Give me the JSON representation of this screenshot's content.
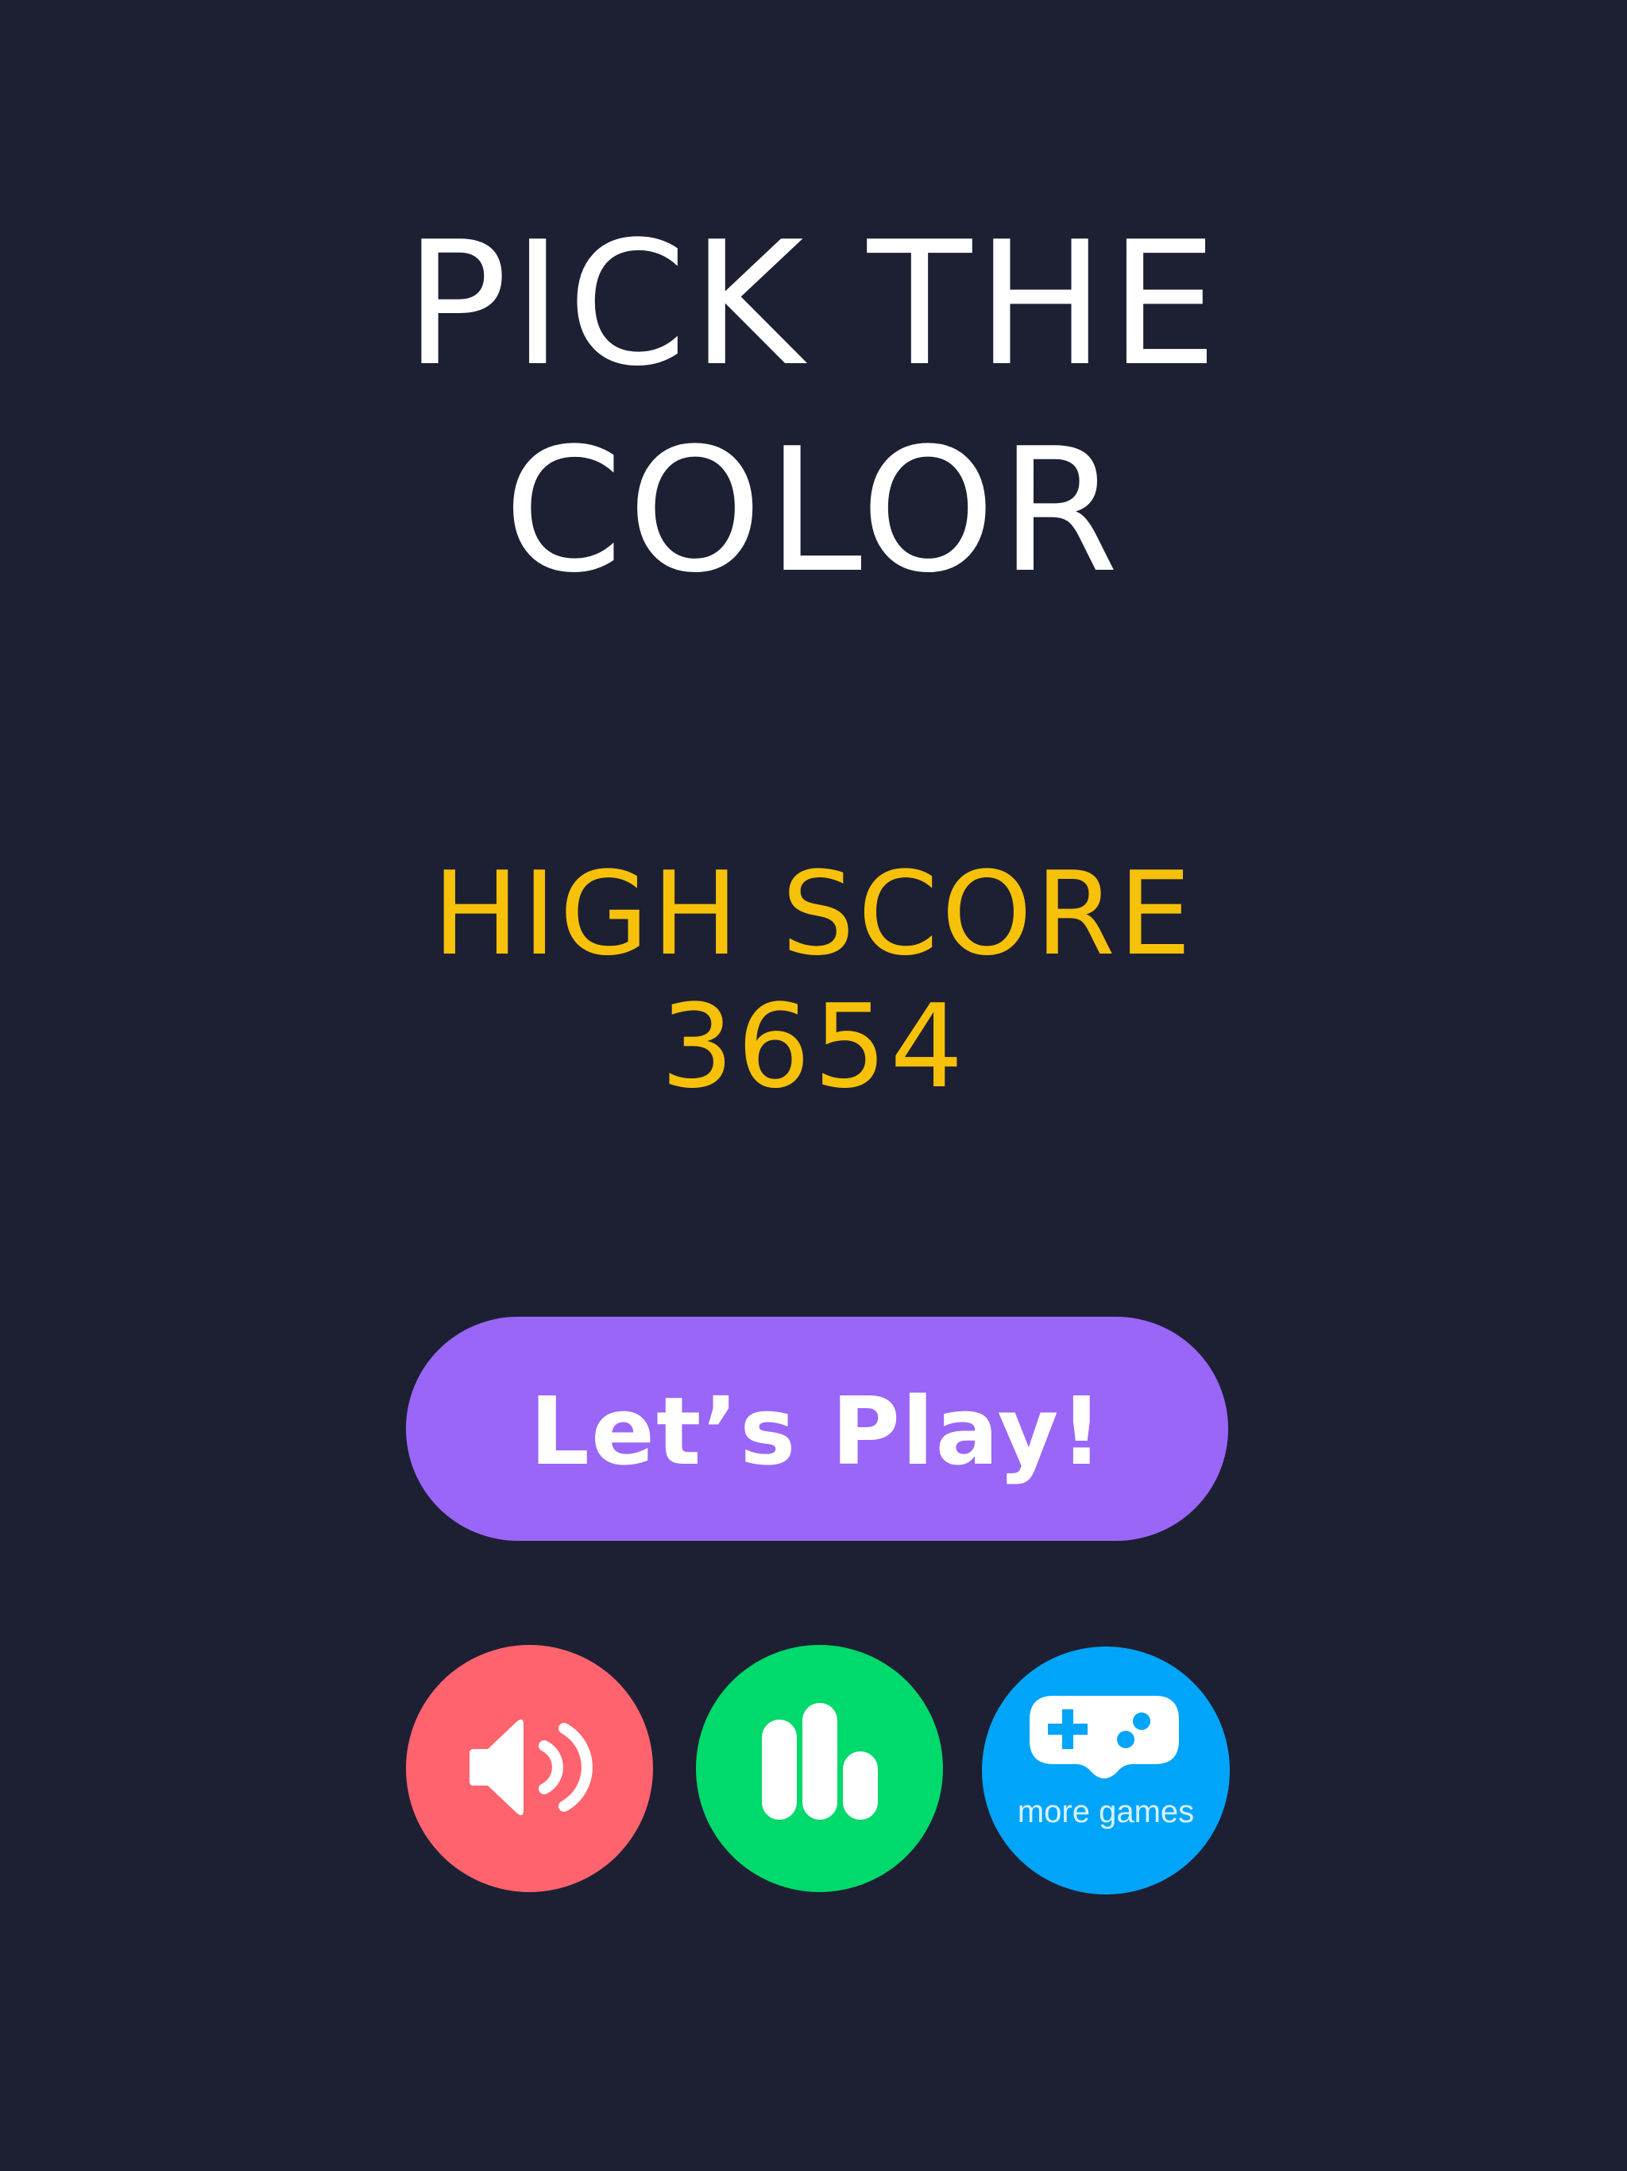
{
  "title": {
    "line1": "PICK THE",
    "line2": "COLOR"
  },
  "high_score": {
    "label": "HIGH SCORE",
    "value": "3654"
  },
  "play_button": {
    "label": "Let’s Play!"
  },
  "controls": {
    "sound": {
      "icon": "speaker-volume-icon"
    },
    "leaderboard": {
      "icon": "bar-chart-icon"
    },
    "more_games": {
      "icon": "gamepad-icon",
      "label": "more games"
    }
  },
  "colors": {
    "background": "#1d2033",
    "title": "#ffffff",
    "score": "#f7c10a",
    "play_button": "#9966f7",
    "sound_button": "#fe636e",
    "leaderboard_button": "#00d96b",
    "more_games_button": "#00a5f9"
  }
}
